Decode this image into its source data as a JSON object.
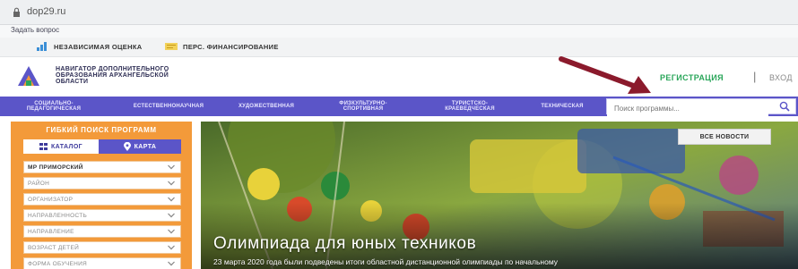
{
  "browser": {
    "url": "dop29.ru"
  },
  "ask_question": "Задать вопрос",
  "bookmarks": [
    {
      "label": "НЕЗАВИСИМАЯ ОЦЕНКА",
      "icon": "chart-icon"
    },
    {
      "label": "ПЕРС. ФИНАНСИРОВАНИЕ",
      "icon": "certificate-icon"
    }
  ],
  "header": {
    "logo_icon": "navigator-logo-icon",
    "title_lines": [
      "НАВИГАТОР ДОПОЛНИТЕЛЬНОГО",
      "ОБРАЗОВАНИЯ АРХАНГЕЛЬСКОЙ",
      "ОБЛАСТИ"
    ],
    "register": "РЕГИСТРАЦИЯ",
    "separator": "|",
    "login": "ВХОД"
  },
  "categories": [
    {
      "l1": "СОЦИАЛЬНО-",
      "l2": "ПЕДАГОГИЧЕСКАЯ"
    },
    {
      "l1": "ЕСТЕСТВЕННОНАУЧНАЯ",
      "l2": ""
    },
    {
      "l1": "ХУДОЖЕСТВЕННАЯ",
      "l2": ""
    },
    {
      "l1": "ФИЗКУЛЬТУРНО-",
      "l2": "СПОРТИВНАЯ"
    },
    {
      "l1": "ТУРИСТСКО-",
      "l2": "КРАЕВЕДЧЕСКАЯ"
    },
    {
      "l1": "ТЕХНИЧЕСКАЯ",
      "l2": ""
    }
  ],
  "search": {
    "placeholder": "Поиск программы..."
  },
  "filter": {
    "title": "ГИБКИЙ ПОИСК ПРОГРАММ",
    "tab_catalog": "КАТАЛОГ",
    "tab_map": "КАРТА",
    "selects": [
      "МР ПРИМОРСКИЙ",
      "РАЙОН",
      "ОРГАНИЗАТОР",
      "НАПРАВЛЕННОСТЬ",
      "НАПРАВЛЕНИЕ",
      "ВОЗРАСТ ДЕТЕЙ",
      "ФОРМА ОБУЧЕНИЯ"
    ]
  },
  "hero": {
    "news_button": "ВСЕ НОВОСТИ",
    "title": "Олимпиада для юных техников",
    "subtitle": "23 марта 2020 года были подведены итоги областной дистанционной олимпиады по начальному"
  },
  "colors": {
    "nav_purple": "#5b55c8",
    "filter_orange": "#f39a3a",
    "register_green": "#2aa65a",
    "arrow_red": "#8b1a2c"
  }
}
